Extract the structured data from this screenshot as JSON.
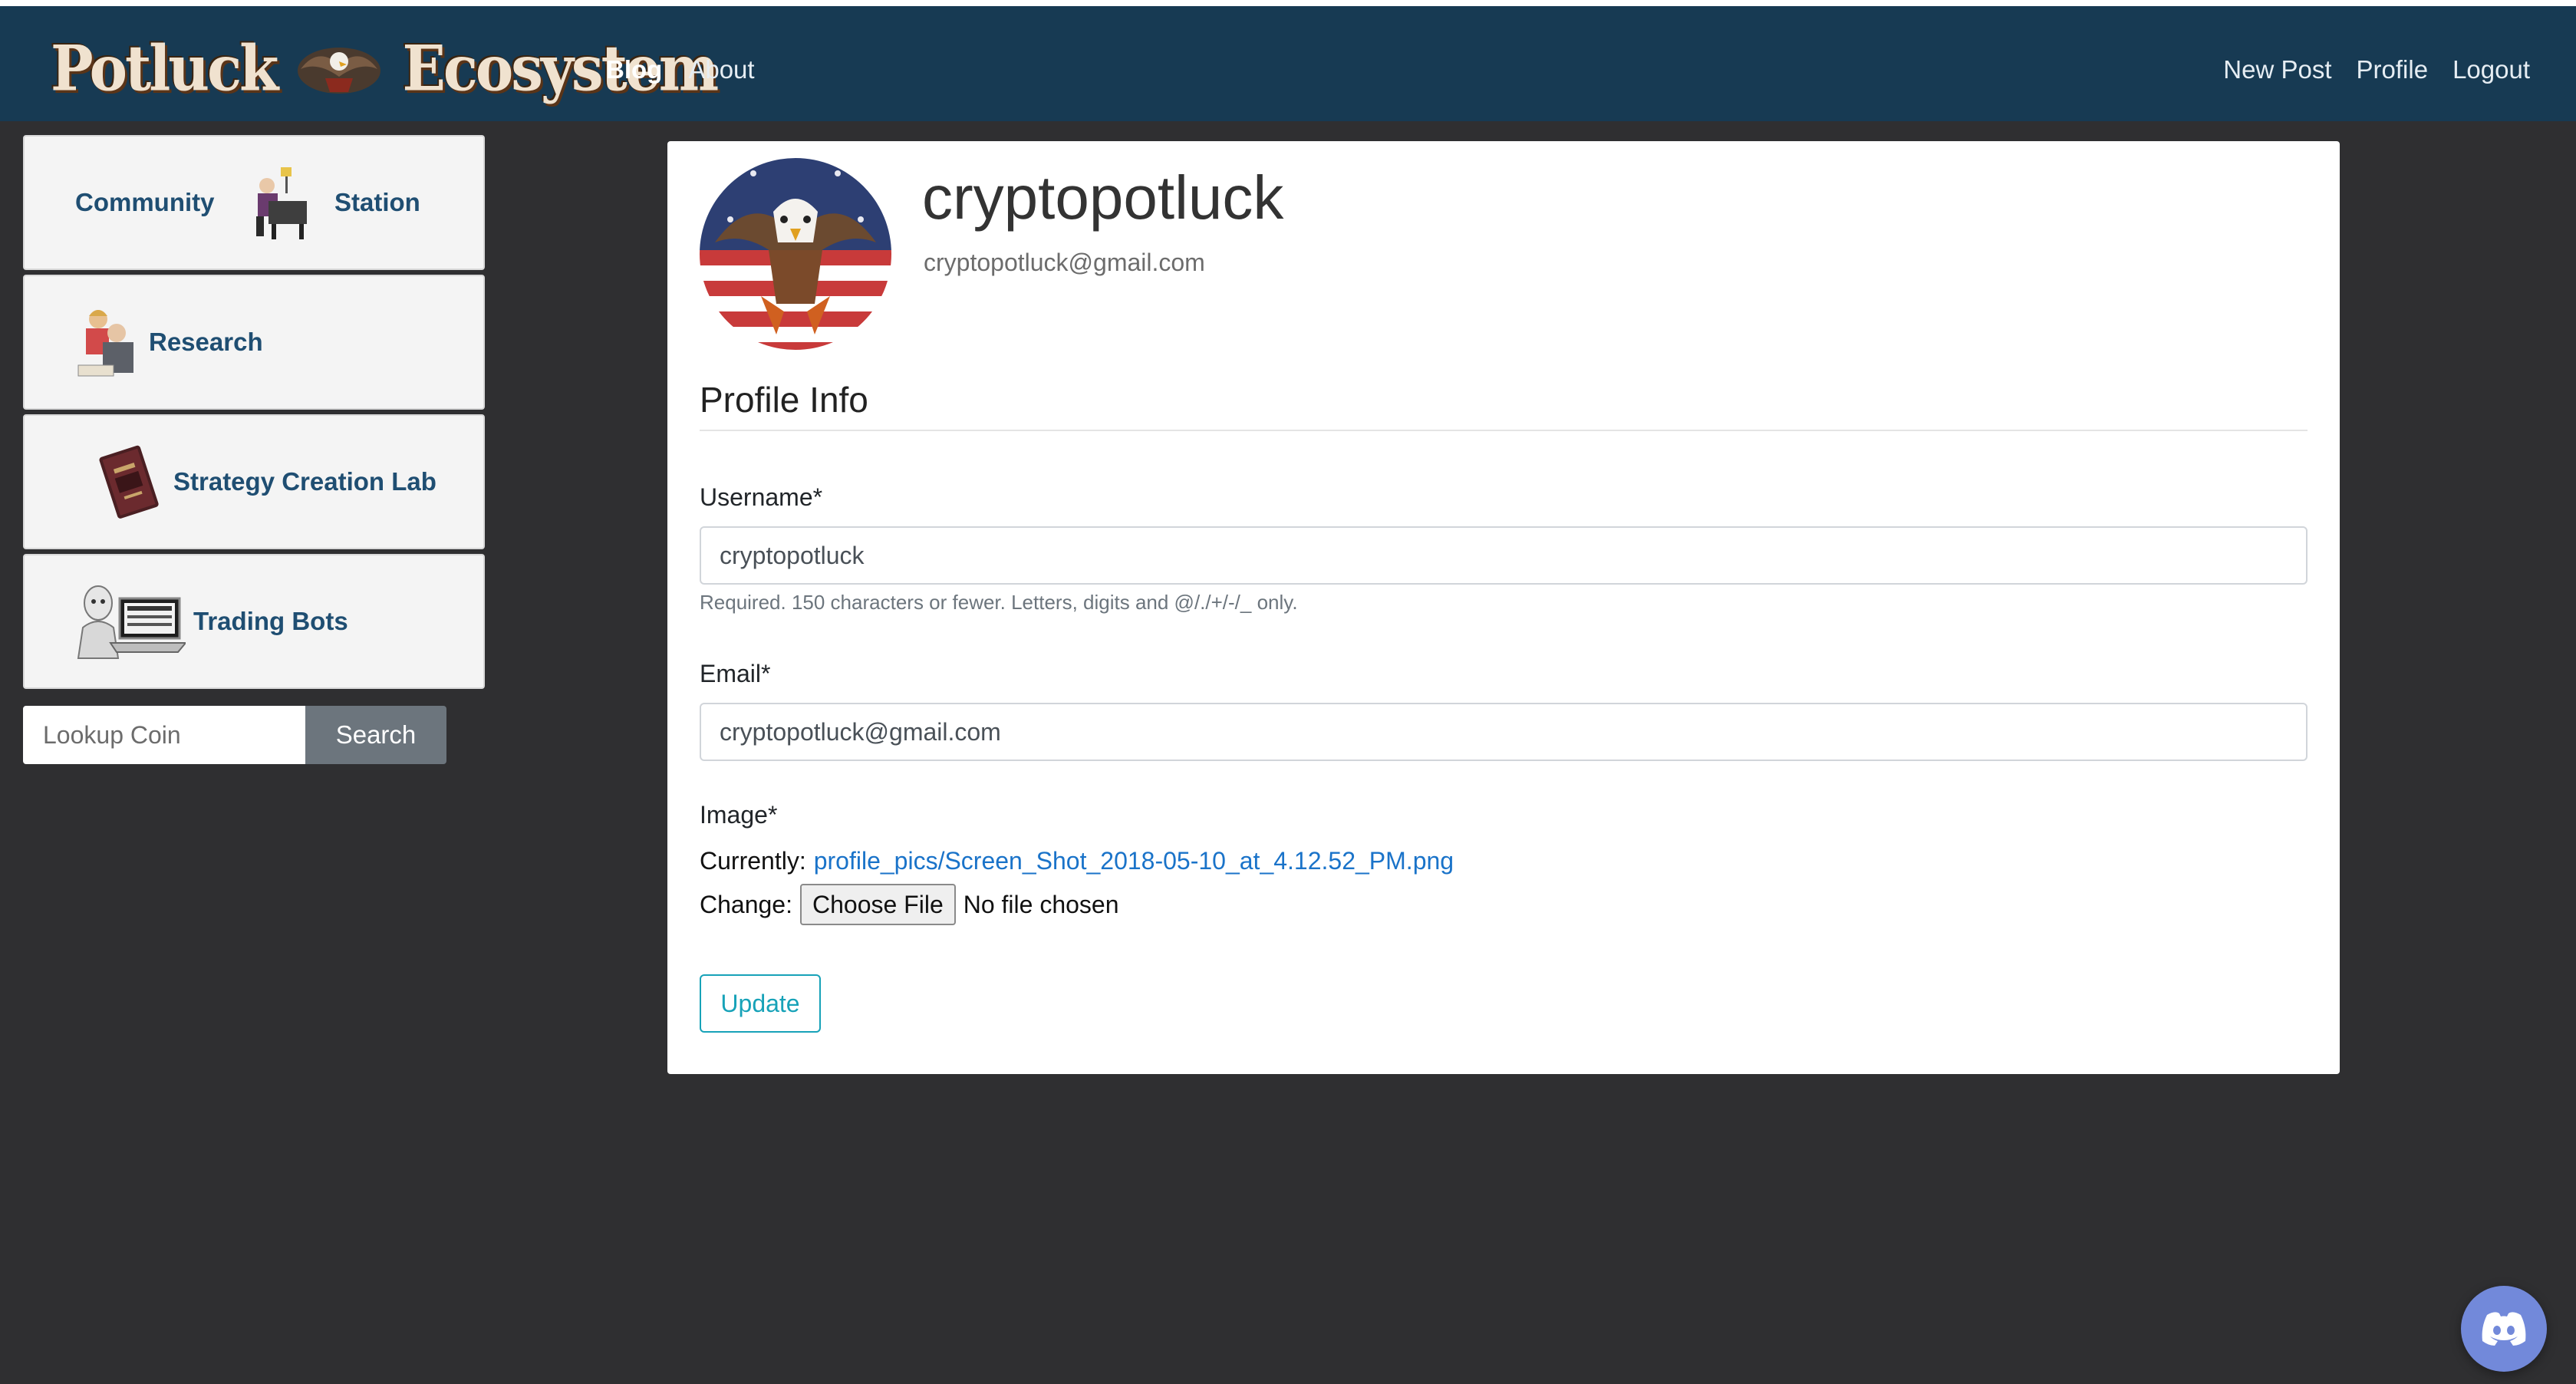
{
  "nav": {
    "brand_left": "Potluck",
    "brand_right": "Ecosystem",
    "left_links": [
      {
        "label": "Blog",
        "active": true
      },
      {
        "label": "About",
        "active": false
      }
    ],
    "right_links": [
      {
        "label": "New Post"
      },
      {
        "label": "Profile"
      },
      {
        "label": "Logout"
      }
    ]
  },
  "sidebar": {
    "items": [
      {
        "label": "Community",
        "label2": "Station",
        "icon": "person-at-desk-icon"
      },
      {
        "label": "Research",
        "icon": "researchers-icon"
      },
      {
        "label": "Strategy Creation Lab",
        "icon": "book-icon"
      },
      {
        "label": "Trading Bots",
        "icon": "robot-laptop-icon"
      }
    ],
    "lookup": {
      "placeholder": "Lookup Coin",
      "button": "Search"
    }
  },
  "profile": {
    "username": "cryptopotluck",
    "email": "cryptopotluck@gmail.com",
    "avatar_icon": "eagle-flag-avatar"
  },
  "form": {
    "legend": "Profile Info",
    "username_label": "Username*",
    "username_value": "cryptopotluck",
    "username_help": "Required. 150 characters or fewer. Letters, digits and @/./+/-/_ only.",
    "email_label": "Email*",
    "email_value": "cryptopotluck@gmail.com",
    "image_label": "Image*",
    "currently_label": "Currently:",
    "currently_link": "profile_pics/Screen_Shot_2018-05-10_at_4.12.52_PM.png",
    "change_label": "Change:",
    "choose_file": "Choose File",
    "no_file": "No file chosen",
    "update_button": "Update"
  },
  "colors": {
    "navbar": "#173a53",
    "page_bg": "#2f2f31",
    "link": "#1a73c9",
    "update_outline": "#17a2b8",
    "discord": "#7289da"
  },
  "floating": {
    "icon": "discord-icon"
  }
}
